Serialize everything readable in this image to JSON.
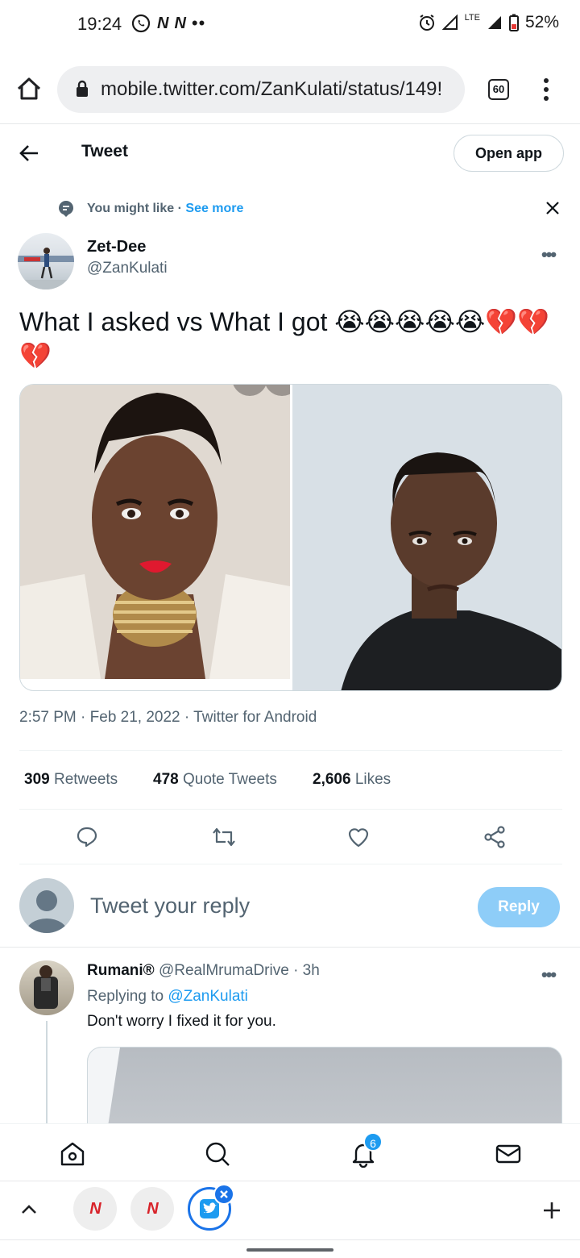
{
  "status_bar": {
    "time": "19:24",
    "network": "LTE",
    "battery": "52%"
  },
  "browser": {
    "url": "mobile.twitter.com/ZanKulati/status/149!",
    "tab_count": "60"
  },
  "header": {
    "title": "Tweet",
    "open_app": "Open app"
  },
  "suggestion": {
    "label": "You might like",
    "separator": "·",
    "see_more": "See more"
  },
  "tweet": {
    "author_name": "Zet-Dee",
    "author_handle": "@ZanKulati",
    "text": "What I asked vs What I got 😭😭😭😭😭💔💔💔",
    "timestamp": "2:57 PM · Feb 21, 2022 · Twitter for Android",
    "stats": {
      "retweets_count": "309",
      "retweets_label": "Retweets",
      "quotes_count": "478",
      "quotes_label": "Quote Tweets",
      "likes_count": "2,606",
      "likes_label": "Likes"
    }
  },
  "composer": {
    "placeholder": "Tweet your reply",
    "reply_button": "Reply"
  },
  "reply": {
    "name": "Rumani®",
    "handle": "@RealMrumaDrive",
    "age": "· 3h",
    "replying_to_label": "Replying to",
    "replying_to_handle": "@ZanKulati",
    "text": "Don't worry I fixed it for you."
  },
  "bottom_nav": {
    "notifications_badge": "6"
  },
  "colors": {
    "accent": "#1d9bf0",
    "reply_button_disabled": "#8ecdf8",
    "secondary_text": "#536471"
  }
}
